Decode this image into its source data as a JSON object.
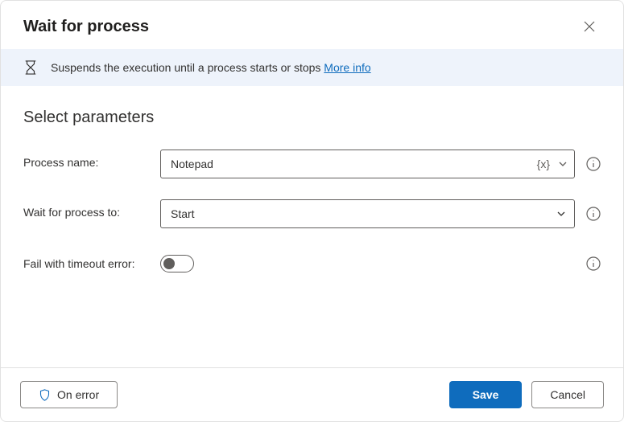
{
  "header": {
    "title": "Wait for process"
  },
  "banner": {
    "text": "Suspends the execution until a process starts or stops ",
    "link": "More info"
  },
  "section": {
    "title": "Select parameters"
  },
  "params": {
    "process_name": {
      "label": "Process name:",
      "value": "Notepad",
      "var_badge": "{x}"
    },
    "wait_for": {
      "label": "Wait for process to:",
      "value": "Start"
    },
    "fail_timeout": {
      "label": "Fail with timeout error:",
      "checked": false
    }
  },
  "footer": {
    "on_error": "On error",
    "save": "Save",
    "cancel": "Cancel"
  }
}
